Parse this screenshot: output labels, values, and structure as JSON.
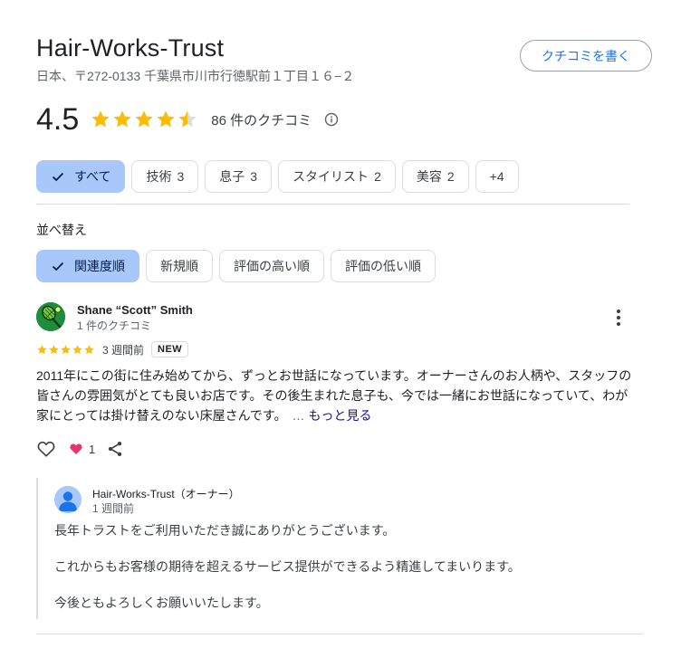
{
  "business": {
    "name": "Hair-Works-Trust",
    "address": "日本、〒272-0133 千葉県市川市行徳駅前１丁目１６−２",
    "write_review_label": "クチコミを書く"
  },
  "rating": {
    "value": "4.5",
    "stars": 4.5,
    "review_count_label": "86 件のクチコミ",
    "star_color": "#fbbc04"
  },
  "filters": [
    {
      "label": "すべて",
      "count": "",
      "selected": true
    },
    {
      "label": "技術",
      "count": "3",
      "selected": false
    },
    {
      "label": "息子",
      "count": "3",
      "selected": false
    },
    {
      "label": "スタイリスト",
      "count": "2",
      "selected": false
    },
    {
      "label": "美容",
      "count": "2",
      "selected": false
    },
    {
      "label": "+4",
      "count": "",
      "selected": false
    }
  ],
  "sort": {
    "label": "並べ替え",
    "options": [
      {
        "label": "関連度順",
        "selected": true
      },
      {
        "label": "新規順",
        "selected": false
      },
      {
        "label": "評価の高い順",
        "selected": false
      },
      {
        "label": "評価の低い順",
        "selected": false
      }
    ]
  },
  "review": {
    "reviewer_name": "Shane “Scott” Smith",
    "reviewer_meta": "1 件のクチコミ",
    "stars": 5,
    "time": "3 週間前",
    "badge": "NEW",
    "text": "2011年にこの街に住み始めてから、ずっとお世話になっています。オーナーさんのお人柄や、スタッフの皆さんの雰囲気がとても良いお店です。その後生まれた息子も、今では一緒にお世話になっていて、わが家にとっては掛け替えのない床屋さんです。",
    "ellipsis": "…",
    "more_label": "もっと見る",
    "reaction_count": "1",
    "icons": [
      "heart-outline-icon",
      "heart-filled-icon",
      "share-icon",
      "more-vert-icon",
      "tennis-racket-icon"
    ]
  },
  "owner_reply": {
    "name": "Hair-Works-Trust（オーナー）",
    "time": "1 週間前",
    "lines": [
      "長年トラストをご利用いただき誠にありがとうございます。",
      "これからもお客様の期待を超えるサービス提供ができるよう精進してまいります。",
      "今後ともよろしくお願いいたします。"
    ]
  },
  "colors": {
    "accent": "#1a73e8",
    "chip_selected_bg": "#a8c7fa",
    "reaction_heart": "#e8336d",
    "avatar_green": "#1e8e3e"
  }
}
